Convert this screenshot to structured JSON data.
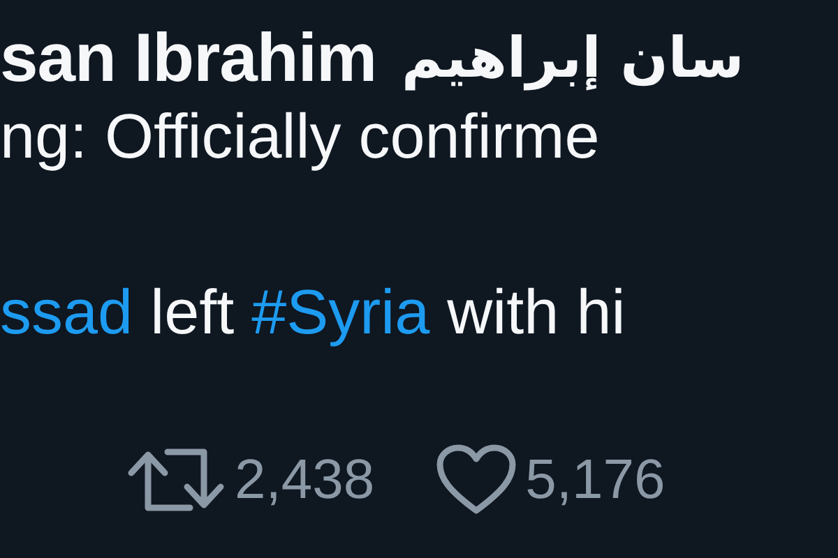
{
  "tweet": {
    "author_name": "san Ibrahim",
    "author_name_arabic": "سان إبراهيم",
    "text_lines": [
      [
        {
          "kind": "text",
          "text": "ng: Officially confirme"
        }
      ],
      [
        {
          "kind": "link",
          "text": "ssad"
        },
        {
          "kind": "text",
          "text": " left "
        },
        {
          "kind": "link",
          "text": "#Syria"
        },
        {
          "kind": "text",
          "text": " with hi"
        }
      ]
    ],
    "stats": [
      {
        "kind": "retweet",
        "count": "2,438"
      },
      {
        "kind": "like",
        "count": "5,176"
      }
    ]
  }
}
